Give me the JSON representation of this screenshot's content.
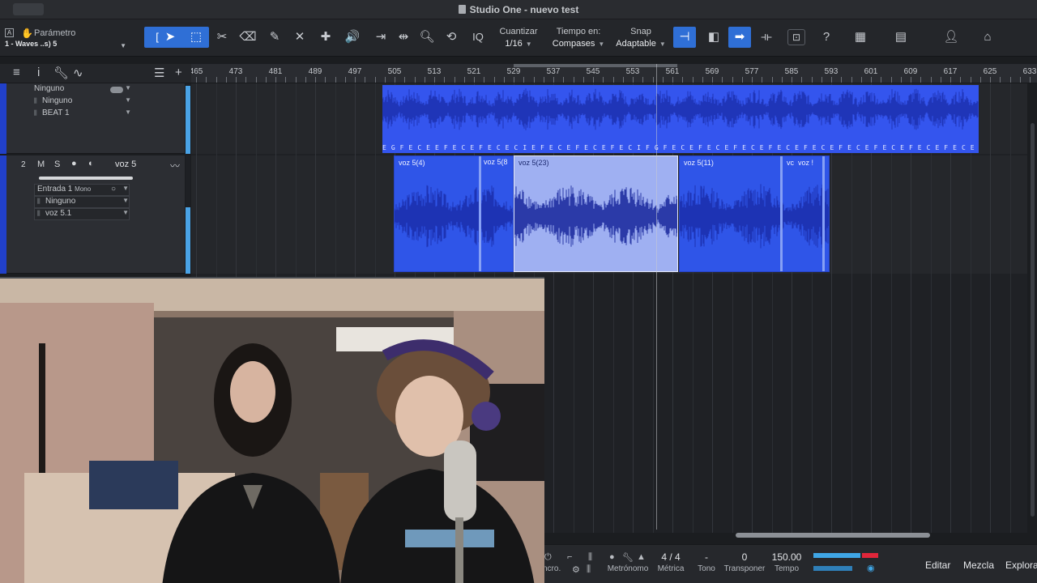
{
  "window": {
    "title": "Studio One - nuevo test"
  },
  "toolbar": {
    "parameter_label": "Parámetro",
    "parameter_value": "1 - Waves ..s) 5",
    "quantize_label": "Cuantizar",
    "quantize_value": "1/16",
    "timebase_label": "Tiempo en:",
    "timebase_value": "Compases",
    "snap_label": "Snap",
    "snap_value": "Adaptable",
    "iq_label": "IQ",
    "help_label": "?"
  },
  "ruler": {
    "first_label": "465",
    "numbers": [
      "473",
      "481",
      "489",
      "497",
      "505",
      "513",
      "521",
      "529",
      "537",
      "545",
      "553",
      "561",
      "569",
      "577",
      "585",
      "593",
      "601",
      "609",
      "617",
      "625",
      "633"
    ]
  },
  "tracks": [
    {
      "number": "",
      "name": "",
      "rows": [
        "Ninguno",
        "Ninguno",
        "BEAT 1"
      ]
    },
    {
      "number": "2",
      "mute_label": "M",
      "solo_label": "S",
      "name": "voz 5",
      "input": "Entrada 1",
      "input_mode": "Mono",
      "rows": [
        "Ninguno",
        "voz 5.1"
      ]
    }
  ],
  "beat_clip": {
    "markers": "E G  F E C E E F E C E F E C E C I E F E C E F E C E F E C I F G  F E C E F E C E F E C E F E C E F E C E F E C E F E C E F E C E F E C E F E C E F E C E F E C E F E C E F"
  },
  "clips": [
    {
      "name": "voz 5(4)",
      "selected": false
    },
    {
      "name": "voz 5(8",
      "selected": false
    },
    {
      "name": "voz 5(23)",
      "selected": true
    },
    {
      "name": "voz 5(11)",
      "selected": false
    },
    {
      "name": "vc",
      "selected": false
    },
    {
      "name": "voz !",
      "selected": false
    }
  ],
  "transport": {
    "sync_label": "ncro.",
    "metronome_label": "Metrónomo",
    "signature_value": "4 / 4",
    "signature_label": "Métrica",
    "key_value": "-",
    "key_label": "Tono",
    "transpose_value": "0",
    "transpose_label": "Transponer",
    "tempo_value": "150.00",
    "tempo_label": "Tempo",
    "tab_edit": "Editar",
    "tab_mix": "Mezcla",
    "tab_browse": "Explora"
  },
  "colors": {
    "accent": "#2f6fd6",
    "clip": "#2f55e8",
    "clip_selected": "#9fb0f2",
    "meter": "#3fa6e6"
  }
}
